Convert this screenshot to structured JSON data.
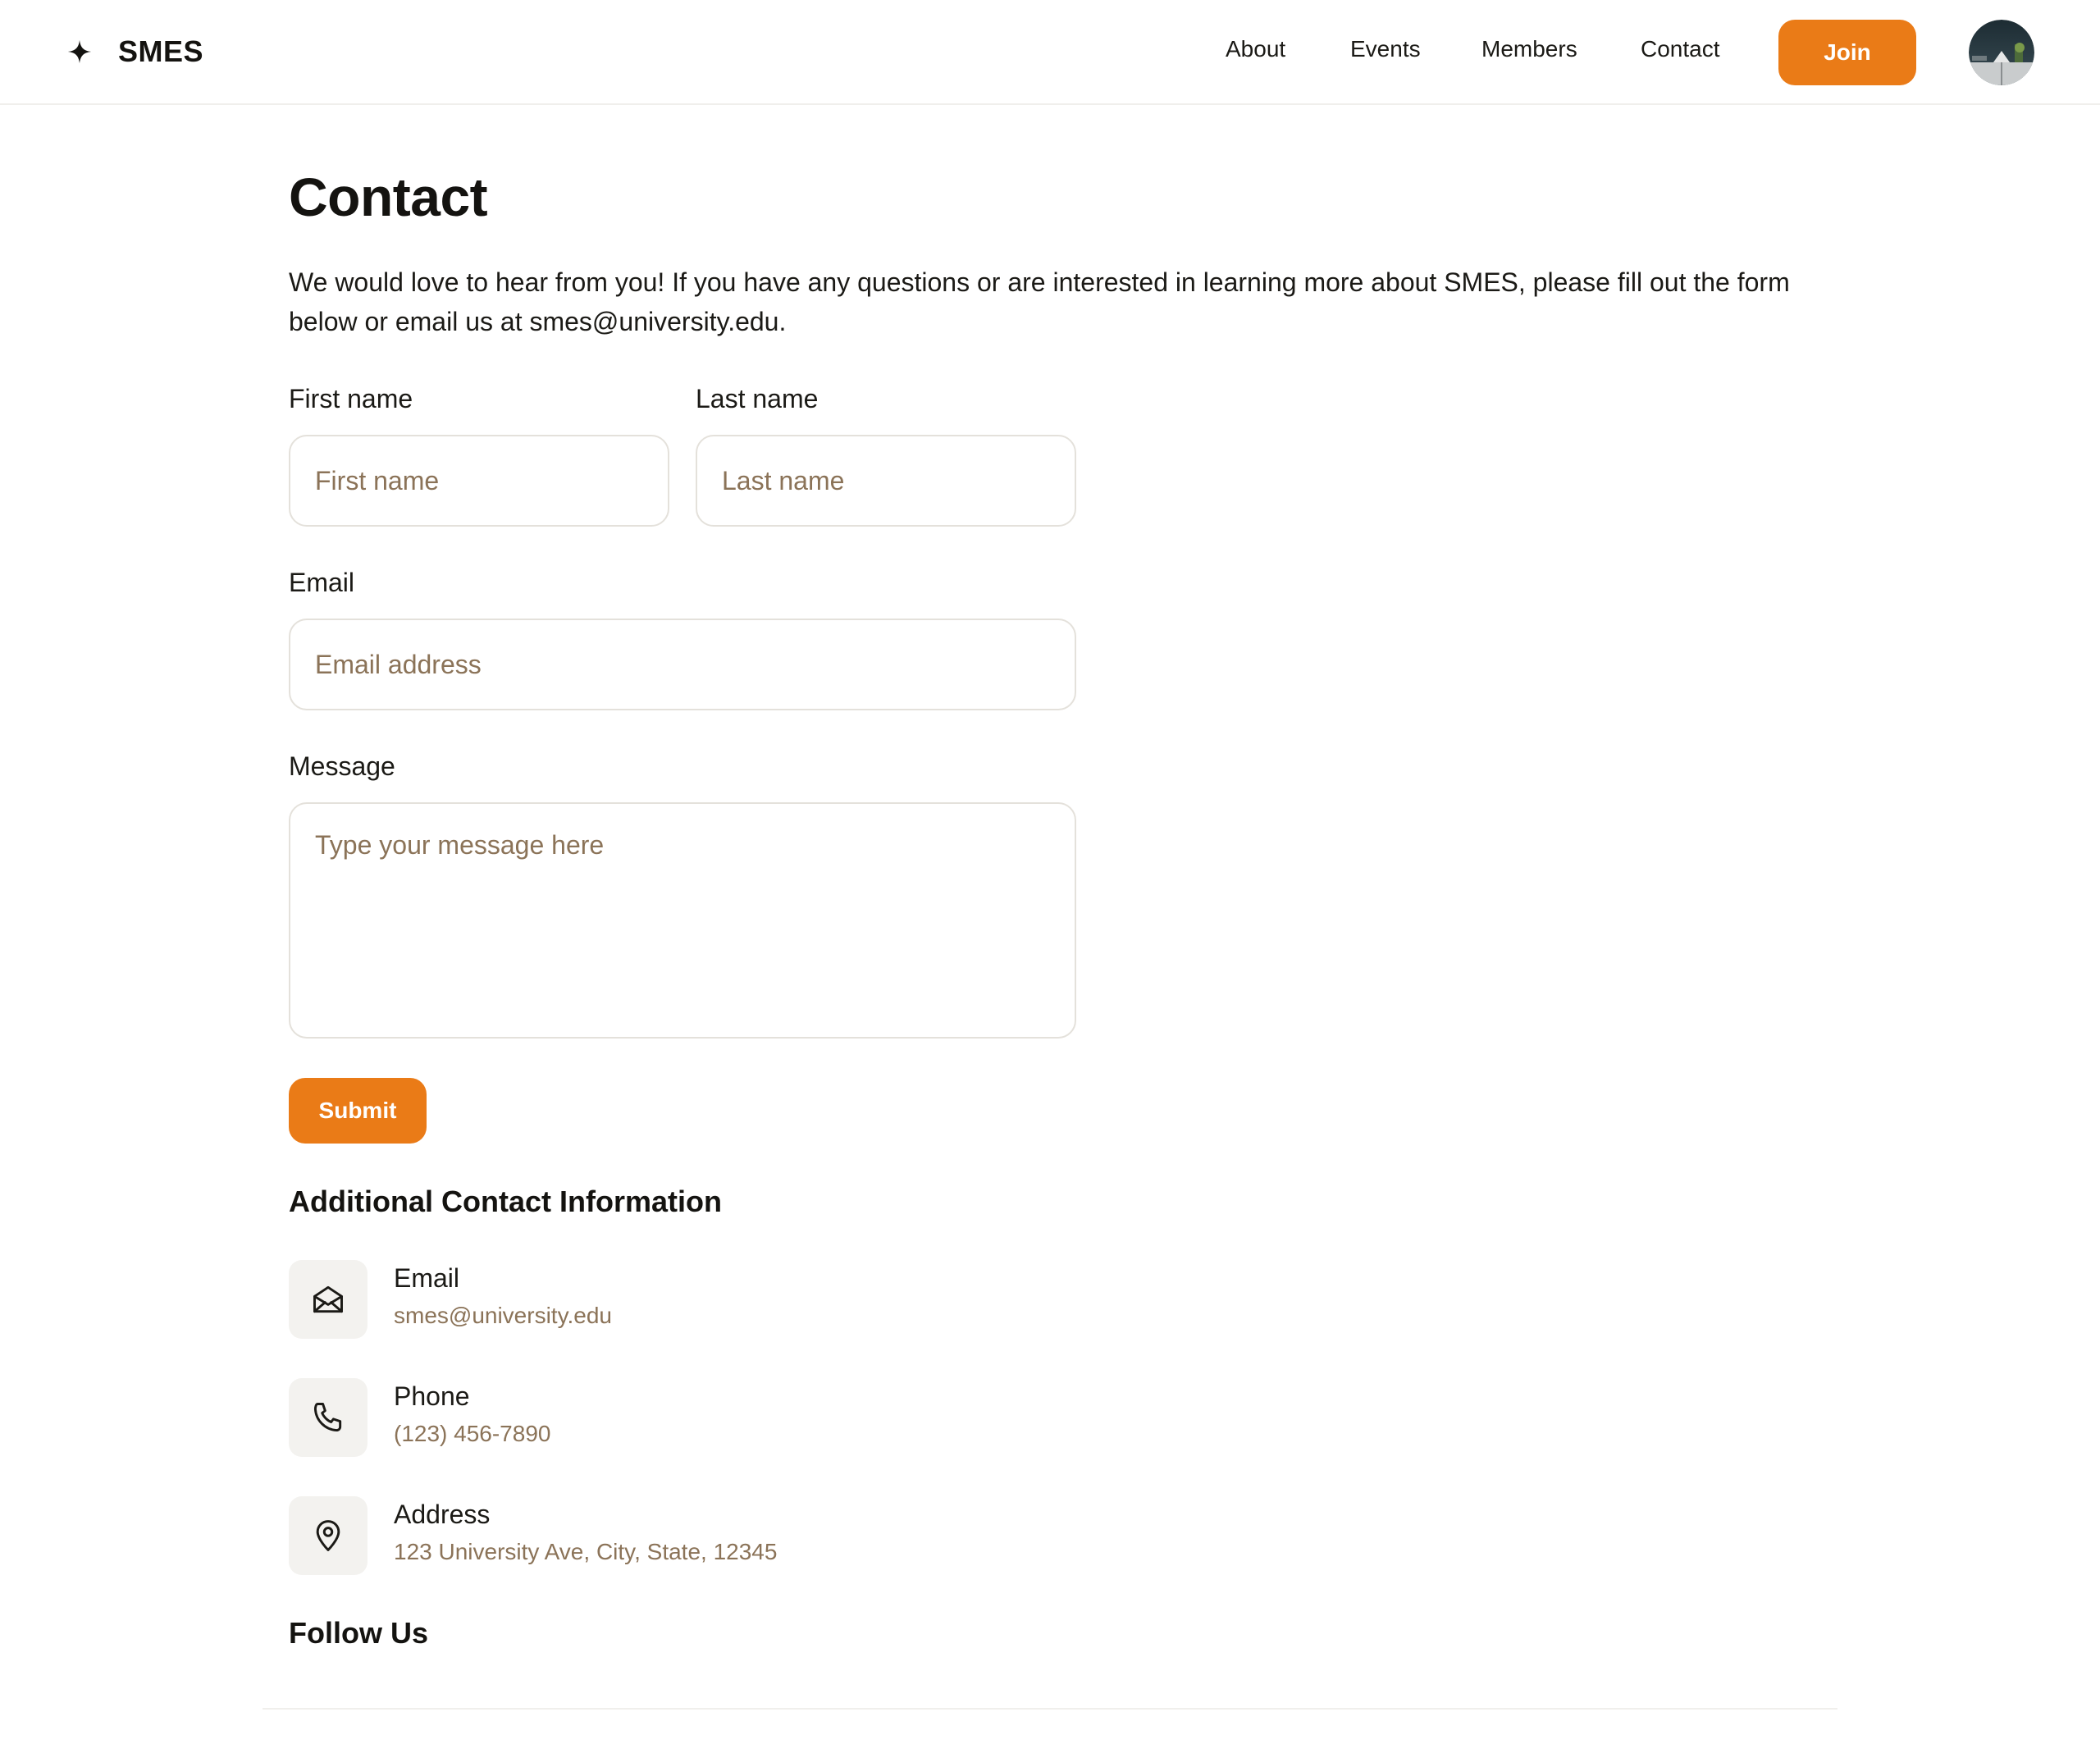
{
  "header": {
    "brand_name": "SMES",
    "nav": [
      {
        "label": "About"
      },
      {
        "label": "Events"
      },
      {
        "label": "Members"
      },
      {
        "label": "Contact"
      }
    ],
    "join_label": "Join"
  },
  "main": {
    "title": "Contact",
    "intro": "We would love to hear from you! If you have any questions or are interested in learning more about SMES, please fill out the form below or email us at smes@university.edu.",
    "form": {
      "first_name": {
        "label": "First name",
        "placeholder": "First name",
        "value": ""
      },
      "last_name": {
        "label": "Last name",
        "placeholder": "Last name",
        "value": ""
      },
      "email": {
        "label": "Email",
        "placeholder": "Email address",
        "value": ""
      },
      "message": {
        "label": "Message",
        "placeholder": "Type your message here",
        "value": ""
      },
      "submit_label": "Submit"
    },
    "additional": {
      "heading": "Additional Contact Information",
      "items": [
        {
          "title": "Email",
          "value": "smes@university.edu",
          "icon": "envelope-open-icon"
        },
        {
          "title": "Phone",
          "value": "(123) 456-7890",
          "icon": "phone-icon"
        },
        {
          "title": "Address",
          "value": "123 University Ave, City, State, 12345",
          "icon": "map-pin-icon"
        }
      ]
    },
    "follow_heading": "Follow Us"
  },
  "colors": {
    "accent": "#ea7b17",
    "text": "#1b1a16",
    "muted": "#8b7358",
    "icon_bg": "#f3f2ef",
    "border": "#e4e1db"
  }
}
